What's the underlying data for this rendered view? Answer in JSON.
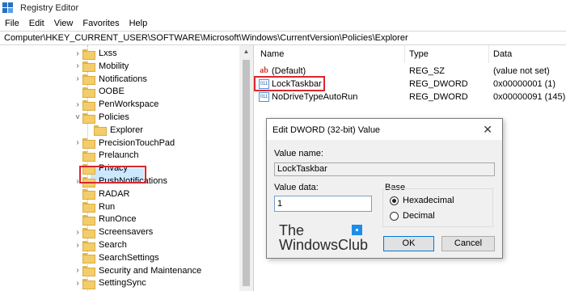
{
  "window": {
    "title": "Registry Editor",
    "app_icon": "registry-icon"
  },
  "menu": [
    "File",
    "Edit",
    "View",
    "Favorites",
    "Help"
  ],
  "address": "Computer\\HKEY_CURRENT_USER\\SOFTWARE\\Microsoft\\Windows\\CurrentVersion\\Policies\\Explorer",
  "tree": {
    "items": [
      {
        "label": "Lxss",
        "expander": "›"
      },
      {
        "label": "Mobility",
        "expander": "›"
      },
      {
        "label": "Notifications",
        "expander": "›"
      },
      {
        "label": "OOBE",
        "expander": ""
      },
      {
        "label": "PenWorkspace",
        "expander": "›"
      },
      {
        "label": "Policies",
        "expander": "˅"
      },
      {
        "label": "Explorer",
        "expander": "",
        "selected": true
      },
      {
        "label": "PrecisionTouchPad",
        "expander": "›"
      },
      {
        "label": "Prelaunch",
        "expander": ""
      },
      {
        "label": "Privacy",
        "expander": ""
      },
      {
        "label": "PushNotifications",
        "expander": "›"
      },
      {
        "label": "RADAR",
        "expander": ""
      },
      {
        "label": "Run",
        "expander": ""
      },
      {
        "label": "RunOnce",
        "expander": ""
      },
      {
        "label": "Screensavers",
        "expander": "›"
      },
      {
        "label": "Search",
        "expander": "›"
      },
      {
        "label": "SearchSettings",
        "expander": ""
      },
      {
        "label": "Security and Maintenance",
        "expander": "›"
      },
      {
        "label": "SettingSync",
        "expander": "›"
      }
    ]
  },
  "list": {
    "headers": {
      "name": "Name",
      "type": "Type",
      "data": "Data"
    },
    "rows": [
      {
        "icon": "string-value-icon",
        "glyph": "ab",
        "name": "(Default)",
        "type": "REG_SZ",
        "data": "(value not set)"
      },
      {
        "icon": "binary-value-icon",
        "glyph": "011",
        "name": "LockTaskbar",
        "type": "REG_DWORD",
        "data": "0x00000001 (1)"
      },
      {
        "icon": "binary-value-icon",
        "glyph": "011",
        "name": "NoDriveTypeAutoRun",
        "type": "REG_DWORD",
        "data": "0x00000091 (145)"
      }
    ]
  },
  "dialog": {
    "title": "Edit DWORD (32-bit) Value",
    "close_glyph": "✕",
    "value_name_label": "Value name:",
    "value_name": "LockTaskbar",
    "value_data_label": "Value data:",
    "value_data": "1",
    "base_label": "Base",
    "base_options": [
      "Hexadecimal",
      "Decimal"
    ],
    "base_selected": "Hexadecimal",
    "ok_label": "OK",
    "cancel_label": "Cancel"
  },
  "watermark": {
    "line1": "The",
    "line2": "WindowsClub"
  }
}
